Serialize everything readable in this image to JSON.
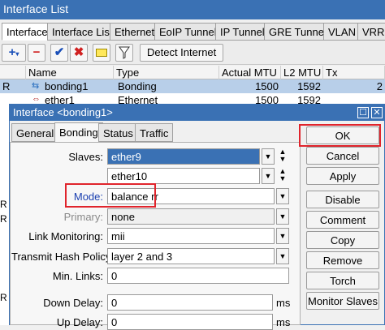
{
  "window": {
    "title": "Interface List"
  },
  "tabs": [
    "Interface",
    "Interface List",
    "Ethernet",
    "EoIP Tunnel",
    "IP Tunnel",
    "GRE Tunnel",
    "VLAN",
    "VRRP"
  ],
  "toolbar": {
    "add_icon": "plus-icon",
    "remove_icon": "minus-icon",
    "enable_icon": "check-icon",
    "disable_icon": "cross-icon",
    "comment_icon": "note-icon",
    "filter_icon": "filter-icon",
    "detect_label": "Detect Internet"
  },
  "table": {
    "columns": [
      "Name",
      "Type",
      "Actual MTU",
      "L2 MTU",
      "Tx"
    ],
    "rows": [
      {
        "flag": "R",
        "name": "bonding1",
        "type": "Bonding",
        "actual_mtu": "1500",
        "l2_mtu": "1592",
        "tx": "2"
      },
      {
        "flag": "",
        "name": "ether1",
        "type": "Ethernet",
        "actual_mtu": "1500",
        "l2_mtu": "1592",
        "tx": ""
      }
    ]
  },
  "left_clip": [
    "R",
    "R",
    "R"
  ],
  "dialog": {
    "title": "Interface <bonding1>",
    "tabs": [
      "General",
      "Bonding",
      "Status",
      "Traffic"
    ],
    "active_tab": "Bonding",
    "fields": {
      "slaves_label": "Slaves:",
      "slave1": "ether9",
      "slave2": "ether10",
      "mode_label": "Mode:",
      "mode_value": "balance rr",
      "primary_label": "Primary:",
      "primary_value": "none",
      "link_monitoring_label": "Link Monitoring:",
      "link_monitoring_value": "mii",
      "hash_policy_label": "Transmit Hash Policy:",
      "hash_policy_value": "layer 2 and 3",
      "min_links_label": "Min. Links:",
      "min_links_value": "0",
      "down_delay_label": "Down Delay:",
      "down_delay_value": "0",
      "down_delay_unit": "ms",
      "up_delay_label": "Up Delay:",
      "up_delay_value": "0",
      "up_delay_unit": "ms"
    },
    "buttons": [
      "OK",
      "Cancel",
      "Apply",
      "Disable",
      "Comment",
      "Copy",
      "Remove",
      "Torch",
      "Monitor Slaves"
    ]
  },
  "colors": {
    "title_blue": "#3a71b4",
    "highlight_red": "#e0242c",
    "selection_blue": "#b8cfe9"
  }
}
